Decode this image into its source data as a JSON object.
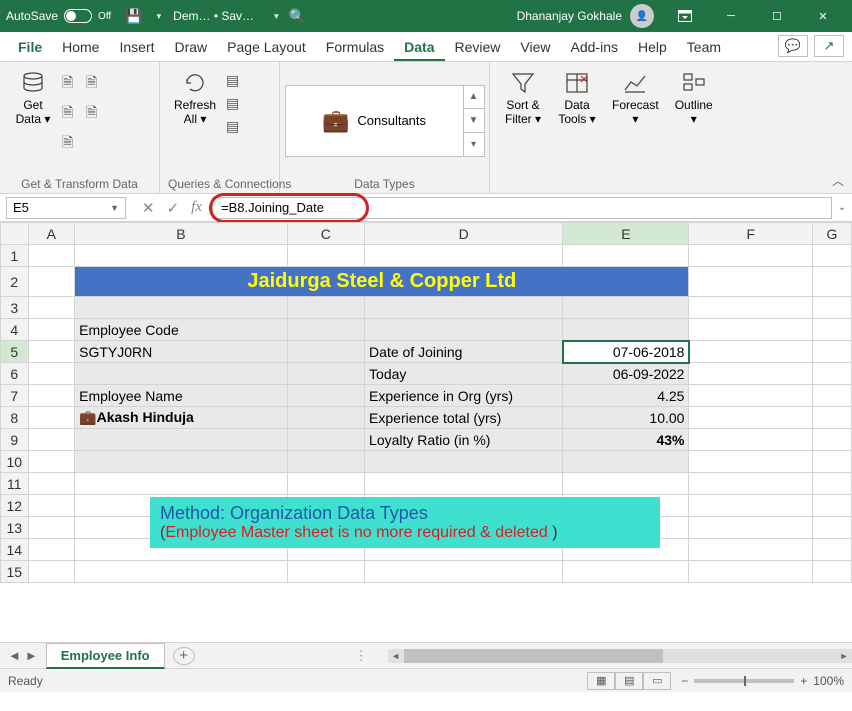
{
  "titlebar": {
    "autosave": "AutoSave",
    "autosave_state": "Off",
    "doc": "Dem… • Sav…",
    "user": "Dhananjay Gokhale"
  },
  "tabs": [
    "File",
    "Home",
    "Insert",
    "Draw",
    "Page Layout",
    "Formulas",
    "Data",
    "Review",
    "View",
    "Add-ins",
    "Help",
    "Team"
  ],
  "active_tab": "Data",
  "ribbon": {
    "get_data": "Get\nData",
    "group1": "Get & Transform Data",
    "refresh": "Refresh\nAll",
    "group2": "Queries & Connections",
    "datatype_item": "Consultants",
    "group3": "Data Types",
    "sort": "Sort &\nFilter",
    "tools": "Data\nTools",
    "forecast": "Forecast",
    "outline": "Outline"
  },
  "formula": {
    "cell": "E5",
    "value": "=B8.Joining_Date"
  },
  "columns": [
    "A",
    "B",
    "C",
    "D",
    "E",
    "F",
    "G"
  ],
  "rows": 15,
  "selected": {
    "row": 5,
    "col": "E"
  },
  "cells": {
    "title": "Jaidurga Steel & Copper Ltd",
    "b4": "Employee Code",
    "b5": "SGTYJ0RN",
    "b7": "Employee Name",
    "b8": "Akash Hinduja",
    "d5": "Date of Joining",
    "d6": "Today",
    "d7": "Experience in Org (yrs)",
    "d8": "Experience total (yrs)",
    "d9": "Loyalty Ratio (in %)",
    "e5": "07-06-2018",
    "e6": "06-09-2022",
    "e7": "4.25",
    "e8": "10.00",
    "e9": "43%"
  },
  "method_box": {
    "line1": "Method: Organization Data Types",
    "line2_a": "(",
    "line2_b": "Employee Master sheet is no more required & deleted",
    "line2_c": " )"
  },
  "sheet_tab": "Employee Info",
  "status": {
    "ready": "Ready",
    "zoom": "100%"
  }
}
